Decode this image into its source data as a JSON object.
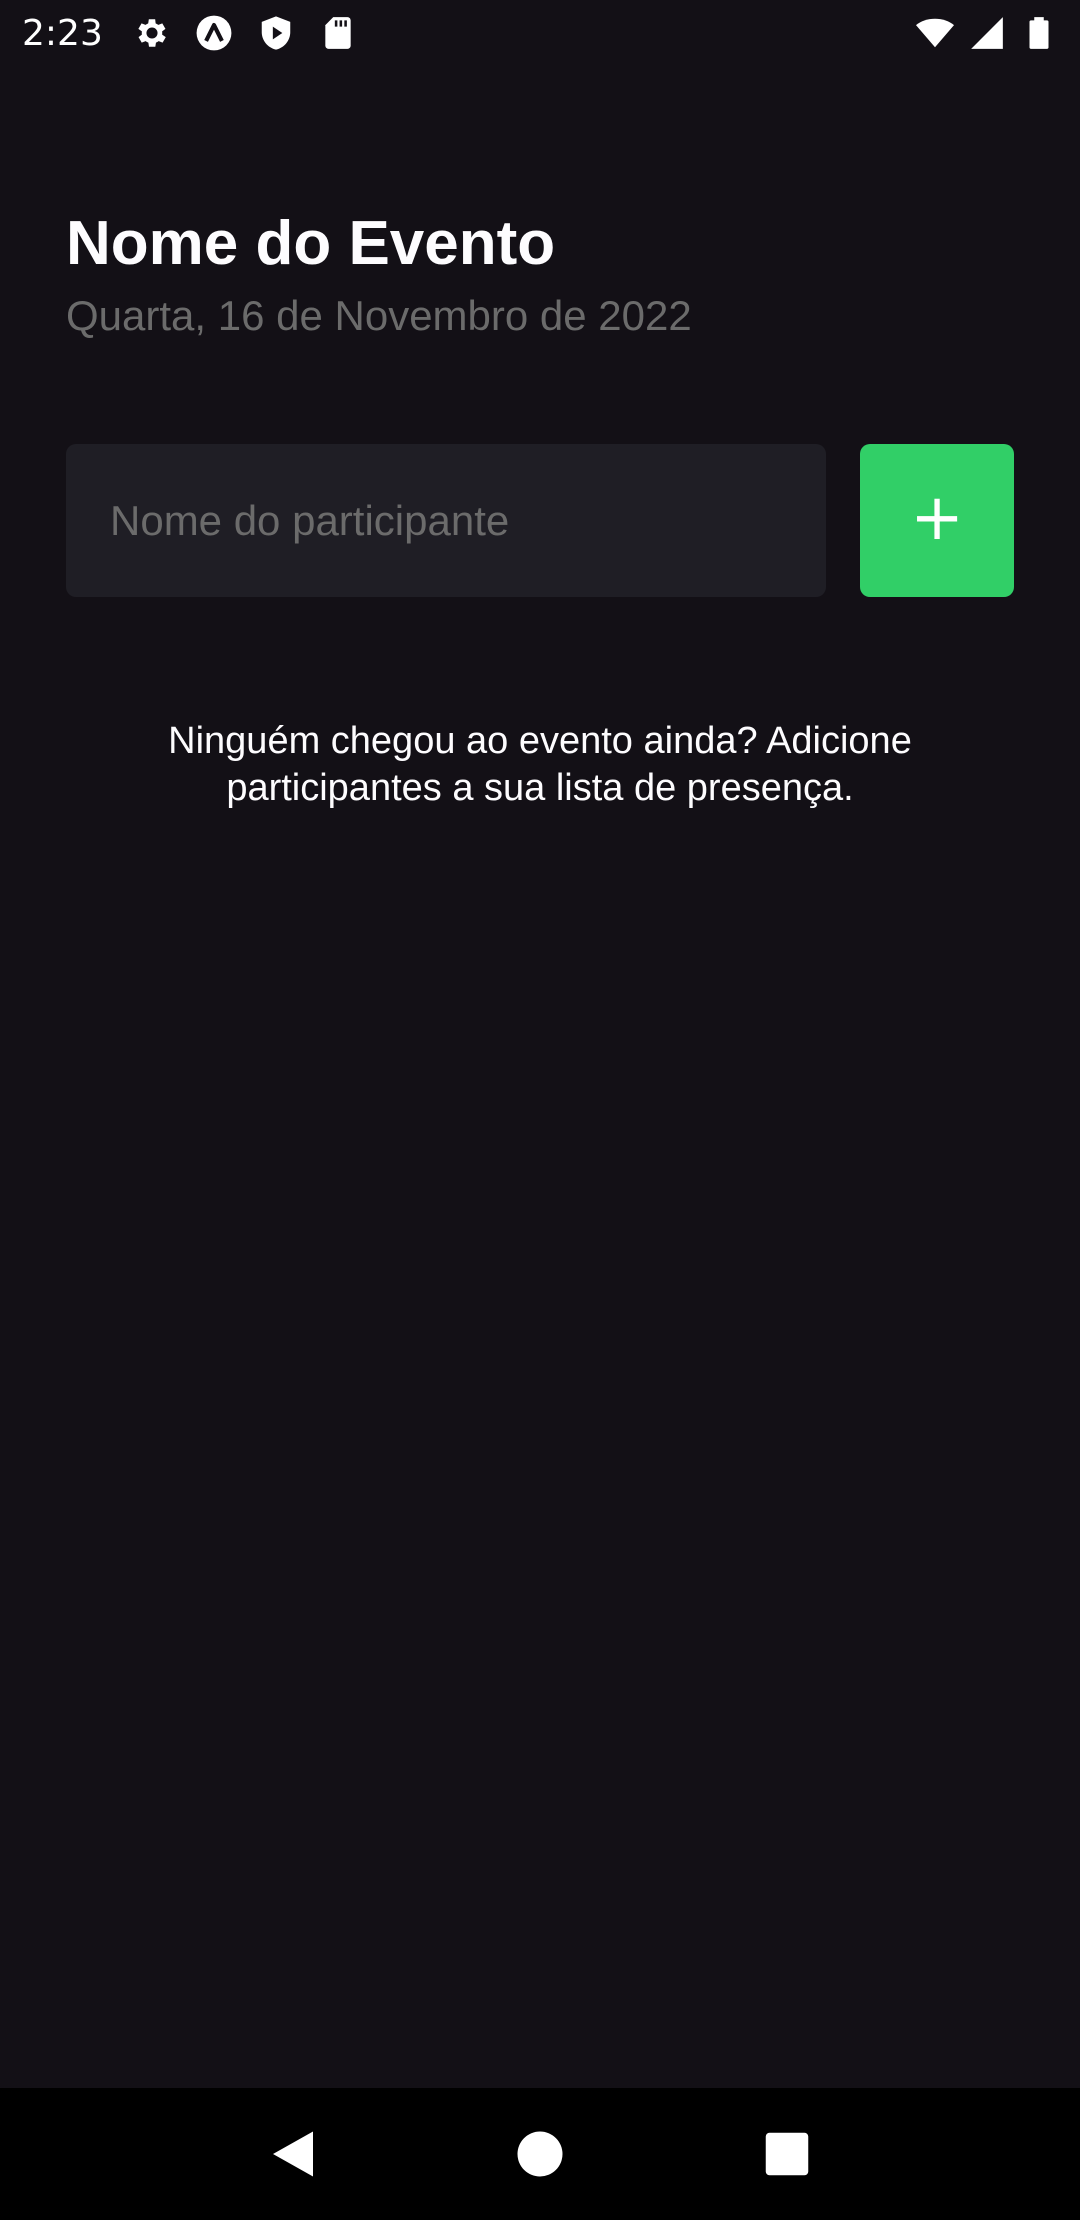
{
  "status_bar": {
    "time": "2:23",
    "left_icons": [
      "settings-icon",
      "app-icon",
      "shield-play-icon",
      "sd-card-icon"
    ],
    "right_icons": [
      "wifi-icon",
      "signal-icon",
      "battery-icon"
    ]
  },
  "header": {
    "title": "Nome do Evento",
    "date": "Quarta, 16 de Novembro de 2022"
  },
  "form": {
    "input_placeholder": "Nome do participante",
    "input_value": "",
    "add_button_label": "+"
  },
  "empty_state": {
    "message": "Ninguém chegou ao evento ainda? Adicione participantes a sua lista de presença."
  },
  "nav_bar": {
    "buttons": [
      "back-icon",
      "home-icon",
      "recents-icon"
    ]
  },
  "colors": {
    "background": "#131016",
    "input_background": "#1f1e25",
    "accent_green": "#31cf67",
    "muted_text": "#6b6b6b",
    "text": "#fdfcfe"
  }
}
